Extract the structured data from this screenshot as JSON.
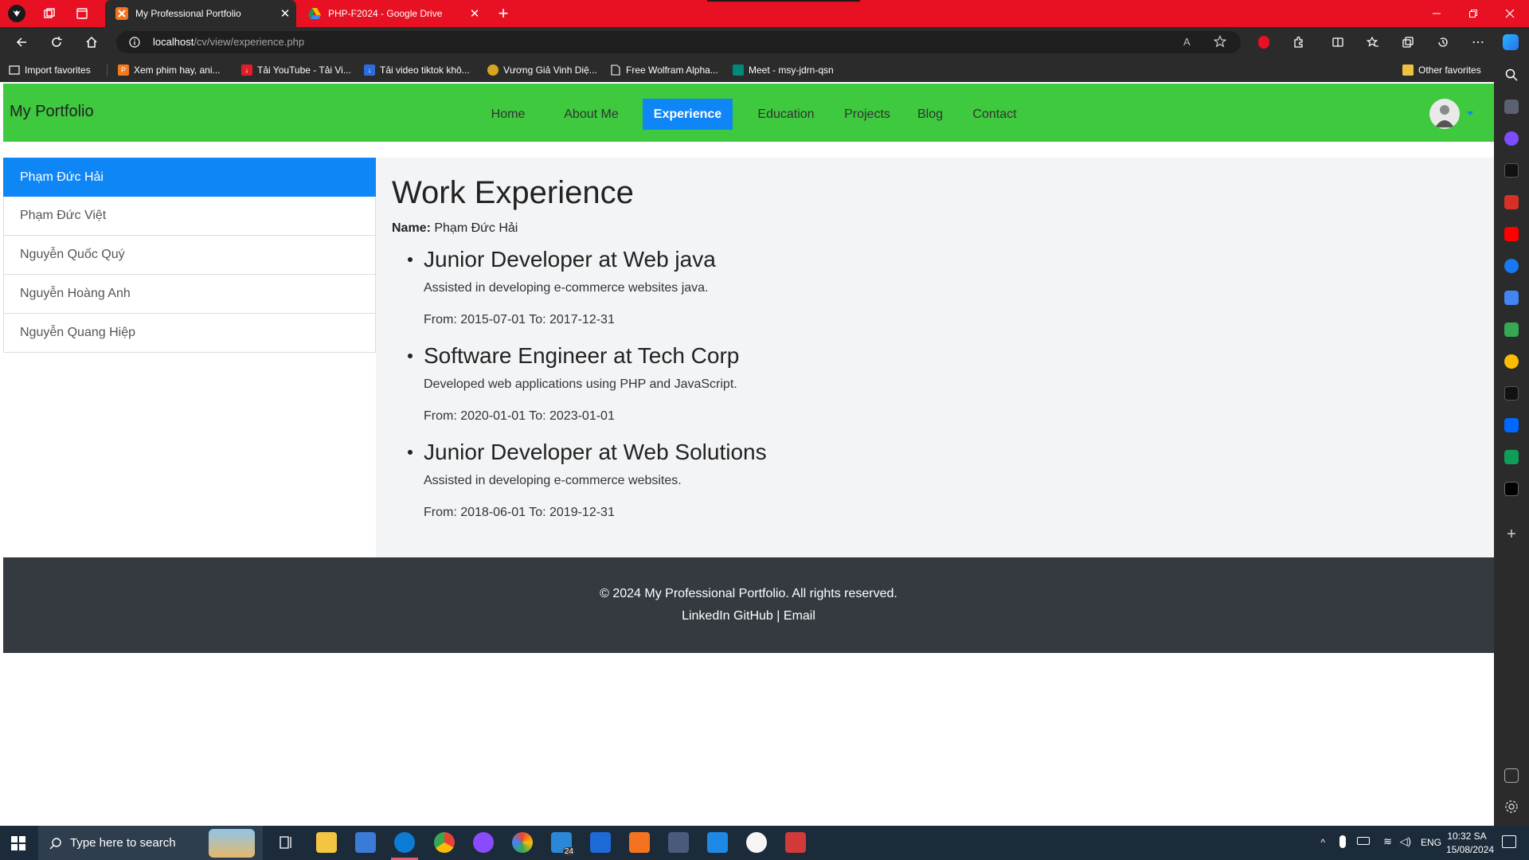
{
  "browser": {
    "tabs": [
      {
        "title": "My Professional Portfolio",
        "active": true
      },
      {
        "title": "PHP-F2024 - Google Drive",
        "active": false
      }
    ],
    "url_host": "localhost",
    "url_path": "/cv/view/experience.php",
    "favorites": [
      "Import favorites",
      "Xem phim hay, ani...",
      "Tải YouTube - Tải Vi...",
      "Tải video tiktok khô...",
      "Vương Giả Vinh Diệ...",
      "Free Wolfram Alpha...",
      "Meet - msy-jdrn-qsn"
    ],
    "other_favorites": "Other favorites"
  },
  "site": {
    "brand": "My Portfolio",
    "nav": [
      {
        "label": "Home",
        "active": false
      },
      {
        "label": "About Me",
        "active": false
      },
      {
        "label": "Experience",
        "active": true
      },
      {
        "label": "Education",
        "active": false
      },
      {
        "label": "Projects",
        "active": false
      },
      {
        "label": "Blog",
        "active": false
      },
      {
        "label": "Contact",
        "active": false
      }
    ],
    "people": [
      {
        "name": "Phạm Đức Hải",
        "active": true
      },
      {
        "name": "Phạm Đức Việt",
        "active": false
      },
      {
        "name": "Nguyễn Quốc Quý",
        "active": false
      },
      {
        "name": "Nguyễn Hoàng Anh",
        "active": false
      },
      {
        "name": "Nguyễn Quang Hiệp",
        "active": false
      }
    ],
    "main": {
      "title": "Work Experience",
      "name_label": "Name:",
      "name_value": "Phạm Đức Hải",
      "jobs": [
        {
          "title": "Junior Developer at Web java",
          "desc": "Assisted in developing e-commerce websites java.",
          "dates": "From: 2015-07-01 To: 2017-12-31"
        },
        {
          "title": "Software Engineer at Tech Corp",
          "desc": "Developed web applications using PHP and JavaScript.",
          "dates": "From: 2020-01-01 To: 2023-01-01"
        },
        {
          "title": "Junior Developer at Web Solutions",
          "desc": "Assisted in developing e-commerce websites.",
          "dates": "From: 2018-06-01 To: 2019-12-31"
        }
      ]
    },
    "footer": {
      "copyright": "© 2024 My Professional Portfolio. All rights reserved.",
      "linkedin": "LinkedIn",
      "github": "GitHub",
      "separator": "|",
      "email": "Email"
    }
  },
  "taskbar": {
    "search_placeholder": "Type here to search",
    "language": "ENG",
    "time": "10:32 SA",
    "date": "15/08/2024",
    "badge_24": "24"
  },
  "colors": {
    "tabbar": "#e81123",
    "navbar": "#3ec93e",
    "accent": "#0f86f6",
    "footer": "#343a40"
  }
}
